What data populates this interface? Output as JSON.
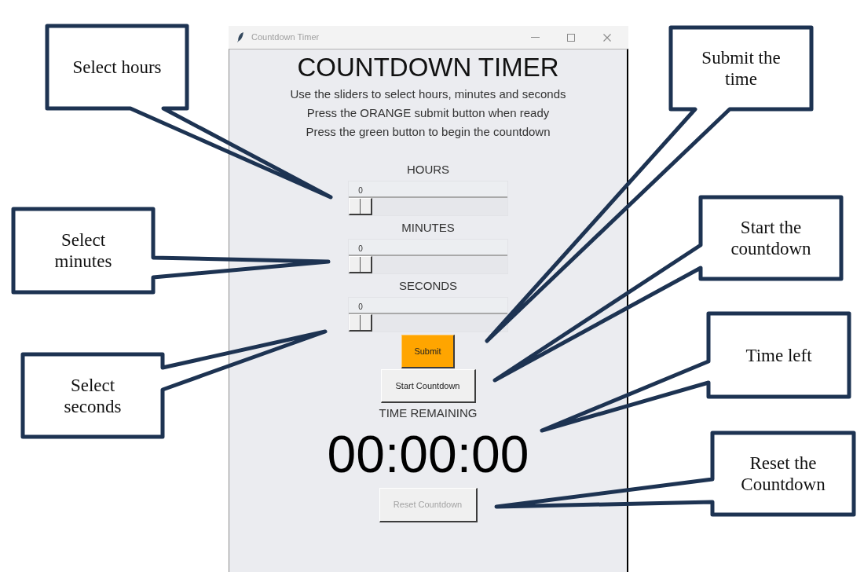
{
  "window": {
    "title": "Countdown Timer"
  },
  "app": {
    "heading": "COUNTDOWN TIMER",
    "instructions": [
      "Use the sliders to select hours, minutes and seconds",
      "Press the ORANGE submit button when ready",
      "Press the green button to begin the countdown"
    ],
    "sliders": [
      {
        "label": "HOURS",
        "value": "0",
        "level": 0
      },
      {
        "label": "MINUTES",
        "value": "0",
        "level": 0
      },
      {
        "label": "SECONDS",
        "value": "0",
        "level": 0
      }
    ],
    "buttons": [
      {
        "label": "Submit",
        "kind": "accent",
        "disabled": false
      },
      {
        "label": "Start Countdown",
        "kind": "standard",
        "disabled": false
      }
    ],
    "time_label": "TIME REMAINING",
    "time_display": "00:00:00",
    "reset_button": {
      "label": "Reset Countdown",
      "disabled": true
    }
  },
  "callouts": [
    {
      "text": "Select hours"
    },
    {
      "text": "Select minutes"
    },
    {
      "text": "Select seconds"
    },
    {
      "text": "Submit the time"
    },
    {
      "text": "Start the countdown"
    },
    {
      "text": "Time left"
    },
    {
      "text": "Reset the Countdown"
    }
  ]
}
